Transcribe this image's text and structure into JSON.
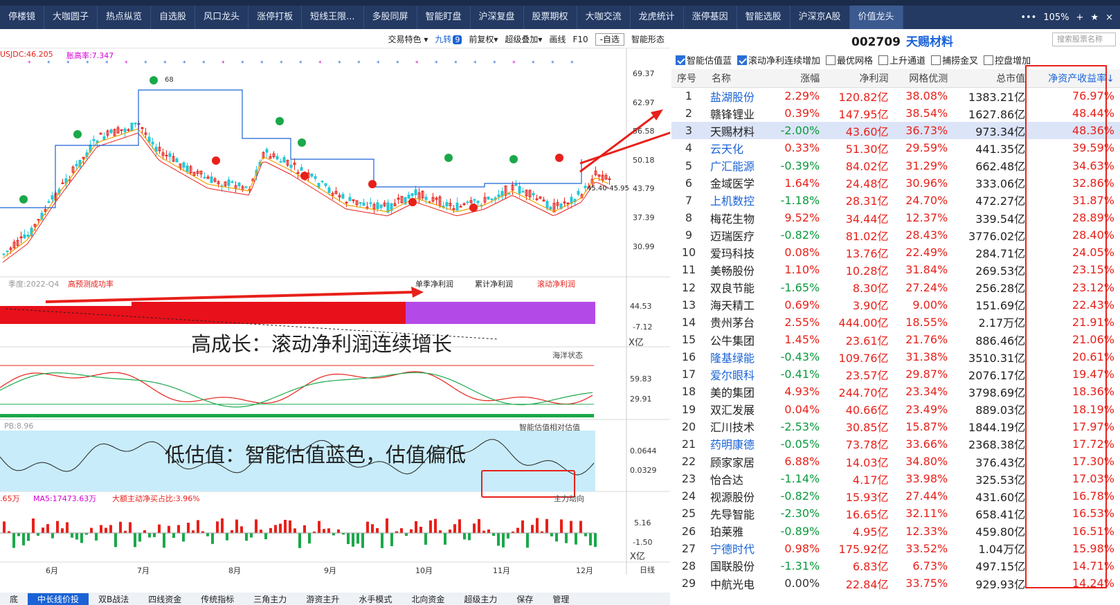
{
  "tabs": [
    "停楼镜",
    "大咖圆子",
    "热点纵览",
    "自选股",
    "风口龙头",
    "涨停打板",
    "短线王限...",
    "多股同屏",
    "智能盯盘",
    "沪深复盘",
    "股票期权",
    "大咖交流",
    "龙虎统计",
    "涨停基因",
    "智能选股",
    "沪深京A股",
    "价值龙头"
  ],
  "tab_right": {
    "dots": "•••",
    "zoom": "105%",
    "plus": "+",
    "star": "★",
    "close": "×"
  },
  "chart_toolbar": {
    "items": [
      "交易特色 ▾",
      "前复权▾",
      "超级叠加▾",
      "画线",
      "F10"
    ],
    "jiuzhuan": "九转",
    "jiuzhuan_badge": "9",
    "self_select": "-自选",
    "smart_shape": "智能形态"
  },
  "stock": {
    "code": "002709",
    "name": "天赐材料",
    "search_placeholder": "搜索股票名称"
  },
  "chart": {
    "indicator1": "USJDC:46.205",
    "indicator2": "胀高率:7.347",
    "price_ticks": [
      "69.37",
      "62.97",
      "56.58",
      "50.18",
      "43.79",
      "37.39",
      "30.99"
    ],
    "price_range_label": "45.40-45.95",
    "label_b": "68",
    "panel2": {
      "season": "季度:2022-Q4",
      "forecast": "高预测成功率",
      "single": "单季净利润",
      "cumulative": "累计净利润",
      "rolling": "滚动净利润",
      "ticks": [
        "44.53",
        "-7.12"
      ],
      "unit": "X亿"
    },
    "overlay1": "高成长：滚动净利润连续增长",
    "panel3": {
      "name": "海洋状态",
      "ticks": [
        "59.83",
        "29.91"
      ]
    },
    "panel4": {
      "pb": "PB:8.96",
      "name": "智能估值相对估值",
      "ticks": [
        "0.0644",
        "0.0329"
      ]
    },
    "overlay2": "低估值：智能估值蓝色，估值偏低",
    "panel5": {
      "v1": ".65万",
      "ma5": "MA5:17473.63万",
      "big": "大额主动净买占比:3.96%",
      "dir": "主力动向",
      "ticks": [
        "5.16",
        "-1.50"
      ],
      "unit": "X亿"
    },
    "months": [
      "6月",
      "7月",
      "8月",
      "9月",
      "10月",
      "11月",
      "12月"
    ],
    "day_line": "日线"
  },
  "bottom_tabs": [
    "底",
    "中长线价投",
    "双B战法",
    "四线资金",
    "传统指标",
    "三角主力",
    "游资主升",
    "水手模式",
    "北向资金",
    "超级主力",
    "保存",
    "管理"
  ],
  "filters": [
    {
      "label": "智能估值蓝",
      "checked": true
    },
    {
      "label": "滚动净利连续增加",
      "checked": true
    },
    {
      "label": "最优网格",
      "checked": false
    },
    {
      "label": "上升通道",
      "checked": false
    },
    {
      "label": "捕捞金叉",
      "checked": false
    },
    {
      "label": "控盘增加",
      "checked": false
    }
  ],
  "table": {
    "headers": [
      "序号",
      "名称",
      "涨幅",
      "净利润",
      "网格优测",
      "总市值",
      "净资产收益率↓"
    ],
    "rows": [
      {
        "i": "1",
        "name": "盐湖股份",
        "blue": true,
        "chg": "2.29%",
        "np": "120.82亿",
        "grid": "38.08%",
        "mv": "1383.21亿",
        "roe": "76.97%"
      },
      {
        "i": "2",
        "name": "赣锋锂业",
        "blue": false,
        "chg": "0.39%",
        "np": "147.95亿",
        "grid": "38.54%",
        "mv": "1627.86亿",
        "roe": "48.44%"
      },
      {
        "i": "3",
        "name": "天赐材料",
        "blue": false,
        "chg": "-2.00%",
        "np": "43.60亿",
        "grid": "36.73%",
        "mv": "973.34亿",
        "roe": "48.36%",
        "sel": true
      },
      {
        "i": "4",
        "name": "云天化",
        "blue": true,
        "chg": "0.33%",
        "np": "51.30亿",
        "grid": "29.59%",
        "mv": "441.35亿",
        "roe": "39.59%"
      },
      {
        "i": "5",
        "name": "广汇能源",
        "blue": true,
        "chg": "-0.39%",
        "np": "84.02亿",
        "grid": "31.29%",
        "mv": "662.48亿",
        "roe": "34.63%"
      },
      {
        "i": "6",
        "name": "金域医学",
        "blue": false,
        "chg": "1.64%",
        "np": "24.48亿",
        "grid": "30.96%",
        "mv": "333.06亿",
        "roe": "32.86%"
      },
      {
        "i": "7",
        "name": "上机数控",
        "blue": true,
        "chg": "-1.18%",
        "np": "28.31亿",
        "grid": "24.70%",
        "mv": "472.27亿",
        "roe": "31.87%"
      },
      {
        "i": "8",
        "name": "梅花生物",
        "blue": false,
        "chg": "9.52%",
        "np": "34.44亿",
        "grid": "12.37%",
        "mv": "339.54亿",
        "roe": "28.89%"
      },
      {
        "i": "9",
        "name": "迈瑞医疗",
        "blue": false,
        "chg": "-0.82%",
        "np": "81.02亿",
        "grid": "28.43%",
        "mv": "3776.02亿",
        "roe": "28.40%"
      },
      {
        "i": "10",
        "name": "爱玛科技",
        "blue": false,
        "chg": "0.08%",
        "np": "13.76亿",
        "grid": "22.49%",
        "mv": "284.71亿",
        "roe": "24.05%"
      },
      {
        "i": "11",
        "name": "美畅股份",
        "blue": false,
        "chg": "1.10%",
        "np": "10.28亿",
        "grid": "31.84%",
        "mv": "269.53亿",
        "roe": "23.15%"
      },
      {
        "i": "12",
        "name": "双良节能",
        "blue": false,
        "chg": "-1.65%",
        "np": "8.30亿",
        "grid": "27.24%",
        "mv": "256.28亿",
        "roe": "23.12%"
      },
      {
        "i": "13",
        "name": "海天精工",
        "blue": false,
        "chg": "0.69%",
        "np": "3.90亿",
        "grid": "9.00%",
        "mv": "151.69亿",
        "roe": "22.43%"
      },
      {
        "i": "14",
        "name": "贵州茅台",
        "blue": false,
        "chg": "2.55%",
        "np": "444.00亿",
        "grid": "18.55%",
        "mv": "2.17万亿",
        "roe": "21.91%"
      },
      {
        "i": "15",
        "name": "公牛集团",
        "blue": false,
        "chg": "1.45%",
        "np": "23.61亿",
        "grid": "21.76%",
        "mv": "886.46亿",
        "roe": "21.06%"
      },
      {
        "i": "16",
        "name": "隆基绿能",
        "blue": true,
        "chg": "-0.43%",
        "np": "109.76亿",
        "grid": "31.38%",
        "mv": "3510.31亿",
        "roe": "20.61%"
      },
      {
        "i": "17",
        "name": "爱尔眼科",
        "blue": true,
        "chg": "-0.41%",
        "np": "23.57亿",
        "grid": "29.87%",
        "mv": "2076.17亿",
        "roe": "19.47%"
      },
      {
        "i": "18",
        "name": "美的集团",
        "blue": false,
        "chg": "4.93%",
        "np": "244.70亿",
        "grid": "23.34%",
        "mv": "3798.69亿",
        "roe": "18.36%"
      },
      {
        "i": "19",
        "name": "双汇发展",
        "blue": false,
        "chg": "0.04%",
        "np": "40.66亿",
        "grid": "23.49%",
        "mv": "889.03亿",
        "roe": "18.19%"
      },
      {
        "i": "20",
        "name": "汇川技术",
        "blue": false,
        "chg": "-2.53%",
        "np": "30.85亿",
        "grid": "15.87%",
        "mv": "1844.19亿",
        "roe": "17.97%"
      },
      {
        "i": "21",
        "name": "药明康德",
        "blue": true,
        "chg": "-0.05%",
        "np": "73.78亿",
        "grid": "33.66%",
        "mv": "2368.38亿",
        "roe": "17.72%"
      },
      {
        "i": "22",
        "name": "顾家家居",
        "blue": false,
        "chg": "6.88%",
        "np": "14.03亿",
        "grid": "34.80%",
        "mv": "376.43亿",
        "roe": "17.30%"
      },
      {
        "i": "23",
        "name": "怡合达",
        "blue": false,
        "chg": "-1.14%",
        "np": "4.17亿",
        "grid": "33.98%",
        "mv": "325.53亿",
        "roe": "17.03%"
      },
      {
        "i": "24",
        "name": "视源股份",
        "blue": false,
        "chg": "-0.82%",
        "np": "15.93亿",
        "grid": "27.44%",
        "mv": "431.60亿",
        "roe": "16.78%"
      },
      {
        "i": "25",
        "name": "先导智能",
        "blue": false,
        "chg": "-2.30%",
        "np": "16.65亿",
        "grid": "32.11%",
        "mv": "658.41亿",
        "roe": "16.53%"
      },
      {
        "i": "26",
        "name": "珀莱雅",
        "blue": false,
        "chg": "-0.89%",
        "np": "4.95亿",
        "grid": "12.33%",
        "mv": "459.80亿",
        "roe": "16.51%"
      },
      {
        "i": "27",
        "name": "宁德时代",
        "blue": true,
        "chg": "0.98%",
        "np": "175.92亿",
        "grid": "33.52%",
        "mv": "1.04万亿",
        "roe": "15.98%"
      },
      {
        "i": "28",
        "name": "国联股份",
        "blue": false,
        "chg": "-1.31%",
        "np": "6.83亿",
        "grid": "6.73%",
        "mv": "497.15亿",
        "roe": "14.71%"
      },
      {
        "i": "29",
        "name": "中航光电",
        "blue": false,
        "chg": "0.00%",
        "np": "22.84亿",
        "grid": "33.75%",
        "mv": "929.93亿",
        "roe": "14.24%"
      }
    ]
  }
}
